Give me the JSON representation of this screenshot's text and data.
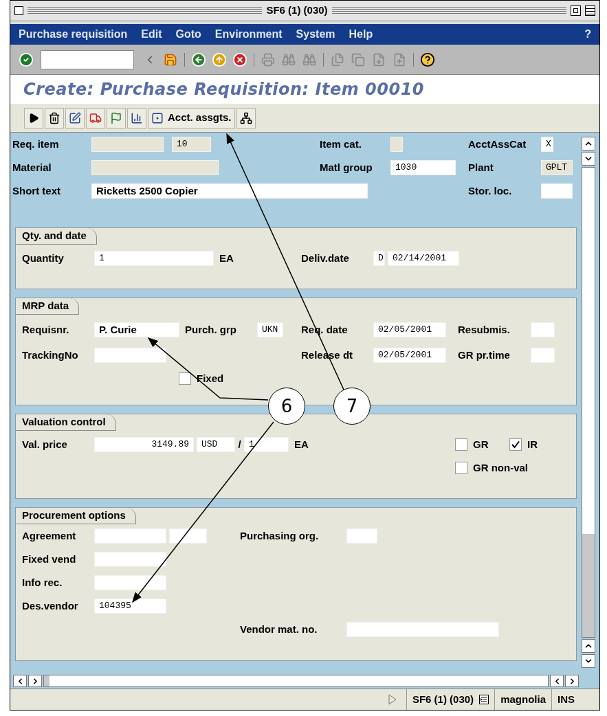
{
  "window": {
    "title": "SF6 (1) (030)"
  },
  "menu": [
    "Purchase requisition",
    "Edit",
    "Goto",
    "Environment",
    "System",
    "Help"
  ],
  "menu_help": "?",
  "screen_title": "Create: Purchase Requisition: Item 00010",
  "app_toolbar": {
    "button_label": "Acct. assgts."
  },
  "header": {
    "req_item": {
      "label": "Req. item",
      "fields": [
        {
          "disabled": true
        },
        {
          "value": "10",
          "disabled": true
        }
      ]
    },
    "item_cat": {
      "label": "Item cat.",
      "fields": [
        {
          "disabled": true
        }
      ]
    },
    "acct_ass_cat": {
      "label": "AcctAssCat",
      "fields": [
        {
          "value": "X",
          "disabled": false
        }
      ]
    },
    "material": {
      "label": "Material",
      "fields": [
        {
          "disabled": true
        }
      ]
    },
    "matl_group": {
      "label": "Matl group",
      "fields": [
        {
          "value": "1030",
          "disabled": false
        }
      ]
    },
    "plant": {
      "label": "Plant",
      "fields": [
        {
          "value": "GPLT",
          "disabled": true
        }
      ]
    },
    "short_text": {
      "label": "Short text",
      "fields": [
        {
          "value": "Ricketts 2500 Copier",
          "disabled": false
        }
      ]
    },
    "stor_loc": {
      "label": "Stor. loc.",
      "fields": [
        {
          "disabled": false
        }
      ]
    }
  },
  "qty_and_date": {
    "title": "Qty. and date",
    "quantity": {
      "label": "Quantity",
      "fields": [
        {
          "value": "1",
          "disabled": false
        }
      ]
    },
    "quantity_unit": "EA",
    "deliv_date": {
      "label": "Deliv.date",
      "fields": [
        {
          "value": "D",
          "disabled": false
        },
        {
          "value": "02/14/2001",
          "disabled": false
        }
      ]
    }
  },
  "mrp_data": {
    "title": "MRP data",
    "requisnr": {
      "label": "Requisnr.",
      "fields": [
        {
          "value": "P. Curie",
          "disabled": false
        }
      ]
    },
    "purch_grp": {
      "label": "Purch. grp",
      "fields": [
        {
          "value": "UKN",
          "disabled": false
        }
      ]
    },
    "req_date": {
      "label": "Req. date",
      "fields": [
        {
          "value": "02/05/2001",
          "disabled": false
        }
      ]
    },
    "resubmis": {
      "label": "Resubmis.",
      "fields": [
        {
          "disabled": false
        }
      ]
    },
    "tracking_no": {
      "label": "TrackingNo",
      "fields": [
        {
          "disabled": false
        }
      ]
    },
    "release_dt": {
      "label": "Release dt",
      "fields": [
        {
          "value": "02/05/2001",
          "disabled": false
        }
      ]
    },
    "gr_pr_time": {
      "label": "GR pr.time",
      "fields": [
        {
          "disabled": false
        }
      ]
    },
    "fixed": {
      "label": "Fixed",
      "checked": false
    }
  },
  "valuation_control": {
    "title": "Valuation control",
    "val_price": {
      "label": "Val. price",
      "fields": [
        {
          "value": "3149.89",
          "disabled": false
        },
        {
          "value": "USD",
          "disabled": false
        },
        {
          "value": "1",
          "disabled": false
        }
      ]
    },
    "slash": "/",
    "unit": "EA",
    "gr": {
      "label": "GR",
      "checked": false
    },
    "ir": {
      "label": "IR",
      "checked": true
    },
    "gr_non_val": {
      "label": "GR non-val",
      "checked": false
    }
  },
  "procurement_options": {
    "title": "Procurement options",
    "agreement": {
      "label": "Agreement",
      "fields": [
        {
          "disabled": false
        },
        {
          "disabled": false
        }
      ]
    },
    "purchasing_org": {
      "label": "Purchasing org.",
      "fields": [
        {
          "disabled": false
        }
      ]
    },
    "fixed_vend": {
      "label": "Fixed vend",
      "fields": [
        {
          "disabled": false
        }
      ]
    },
    "info_rec": {
      "label": "Info rec.",
      "fields": [
        {
          "disabled": false
        }
      ]
    },
    "des_vendor": {
      "label": "Des.vendor",
      "fields": [
        {
          "value": "104395",
          "disabled": false
        }
      ]
    },
    "vendor_mat_no": {
      "label": "Vendor mat. no.",
      "fields": [
        {
          "disabled": false
        }
      ]
    }
  },
  "status_bar": {
    "session": "SF6 (1) (030)",
    "server": "magnolia",
    "mode": "INS"
  },
  "callouts": [
    {
      "label": "6"
    },
    {
      "label": "7"
    }
  ]
}
